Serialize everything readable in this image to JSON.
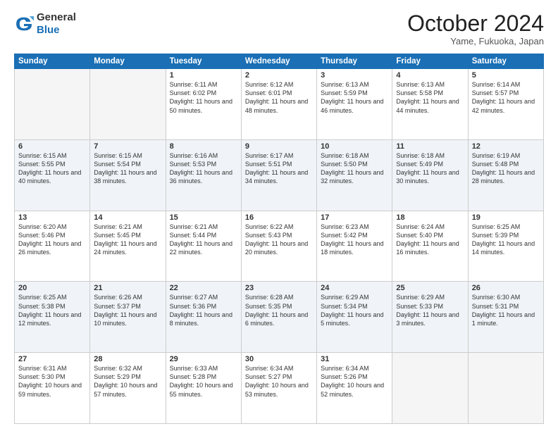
{
  "logo": {
    "general": "General",
    "blue": "Blue"
  },
  "header": {
    "month": "October 2024",
    "location": "Yame, Fukuoka, Japan"
  },
  "weekdays": [
    "Sunday",
    "Monday",
    "Tuesday",
    "Wednesday",
    "Thursday",
    "Friday",
    "Saturday"
  ],
  "rows": [
    [
      {
        "day": "",
        "empty": true
      },
      {
        "day": "",
        "empty": true
      },
      {
        "day": "1",
        "sunrise": "6:11 AM",
        "sunset": "6:02 PM",
        "daylight": "11 hours and 50 minutes."
      },
      {
        "day": "2",
        "sunrise": "6:12 AM",
        "sunset": "6:01 PM",
        "daylight": "11 hours and 48 minutes."
      },
      {
        "day": "3",
        "sunrise": "6:13 AM",
        "sunset": "5:59 PM",
        "daylight": "11 hours and 46 minutes."
      },
      {
        "day": "4",
        "sunrise": "6:13 AM",
        "sunset": "5:58 PM",
        "daylight": "11 hours and 44 minutes."
      },
      {
        "day": "5",
        "sunrise": "6:14 AM",
        "sunset": "5:57 PM",
        "daylight": "11 hours and 42 minutes."
      }
    ],
    [
      {
        "day": "6",
        "sunrise": "6:15 AM",
        "sunset": "5:55 PM",
        "daylight": "11 hours and 40 minutes."
      },
      {
        "day": "7",
        "sunrise": "6:15 AM",
        "sunset": "5:54 PM",
        "daylight": "11 hours and 38 minutes."
      },
      {
        "day": "8",
        "sunrise": "6:16 AM",
        "sunset": "5:53 PM",
        "daylight": "11 hours and 36 minutes."
      },
      {
        "day": "9",
        "sunrise": "6:17 AM",
        "sunset": "5:51 PM",
        "daylight": "11 hours and 34 minutes."
      },
      {
        "day": "10",
        "sunrise": "6:18 AM",
        "sunset": "5:50 PM",
        "daylight": "11 hours and 32 minutes."
      },
      {
        "day": "11",
        "sunrise": "6:18 AM",
        "sunset": "5:49 PM",
        "daylight": "11 hours and 30 minutes."
      },
      {
        "day": "12",
        "sunrise": "6:19 AM",
        "sunset": "5:48 PM",
        "daylight": "11 hours and 28 minutes."
      }
    ],
    [
      {
        "day": "13",
        "sunrise": "6:20 AM",
        "sunset": "5:46 PM",
        "daylight": "11 hours and 26 minutes."
      },
      {
        "day": "14",
        "sunrise": "6:21 AM",
        "sunset": "5:45 PM",
        "daylight": "11 hours and 24 minutes."
      },
      {
        "day": "15",
        "sunrise": "6:21 AM",
        "sunset": "5:44 PM",
        "daylight": "11 hours and 22 minutes."
      },
      {
        "day": "16",
        "sunrise": "6:22 AM",
        "sunset": "5:43 PM",
        "daylight": "11 hours and 20 minutes."
      },
      {
        "day": "17",
        "sunrise": "6:23 AM",
        "sunset": "5:42 PM",
        "daylight": "11 hours and 18 minutes."
      },
      {
        "day": "18",
        "sunrise": "6:24 AM",
        "sunset": "5:40 PM",
        "daylight": "11 hours and 16 minutes."
      },
      {
        "day": "19",
        "sunrise": "6:25 AM",
        "sunset": "5:39 PM",
        "daylight": "11 hours and 14 minutes."
      }
    ],
    [
      {
        "day": "20",
        "sunrise": "6:25 AM",
        "sunset": "5:38 PM",
        "daylight": "11 hours and 12 minutes."
      },
      {
        "day": "21",
        "sunrise": "6:26 AM",
        "sunset": "5:37 PM",
        "daylight": "11 hours and 10 minutes."
      },
      {
        "day": "22",
        "sunrise": "6:27 AM",
        "sunset": "5:36 PM",
        "daylight": "11 hours and 8 minutes."
      },
      {
        "day": "23",
        "sunrise": "6:28 AM",
        "sunset": "5:35 PM",
        "daylight": "11 hours and 6 minutes."
      },
      {
        "day": "24",
        "sunrise": "6:29 AM",
        "sunset": "5:34 PM",
        "daylight": "11 hours and 5 minutes."
      },
      {
        "day": "25",
        "sunrise": "6:29 AM",
        "sunset": "5:33 PM",
        "daylight": "11 hours and 3 minutes."
      },
      {
        "day": "26",
        "sunrise": "6:30 AM",
        "sunset": "5:31 PM",
        "daylight": "11 hours and 1 minute."
      }
    ],
    [
      {
        "day": "27",
        "sunrise": "6:31 AM",
        "sunset": "5:30 PM",
        "daylight": "10 hours and 59 minutes."
      },
      {
        "day": "28",
        "sunrise": "6:32 AM",
        "sunset": "5:29 PM",
        "daylight": "10 hours and 57 minutes."
      },
      {
        "day": "29",
        "sunrise": "6:33 AM",
        "sunset": "5:28 PM",
        "daylight": "10 hours and 55 minutes."
      },
      {
        "day": "30",
        "sunrise": "6:34 AM",
        "sunset": "5:27 PM",
        "daylight": "10 hours and 53 minutes."
      },
      {
        "day": "31",
        "sunrise": "6:34 AM",
        "sunset": "5:26 PM",
        "daylight": "10 hours and 52 minutes."
      },
      {
        "day": "",
        "empty": true
      },
      {
        "day": "",
        "empty": true
      }
    ]
  ]
}
